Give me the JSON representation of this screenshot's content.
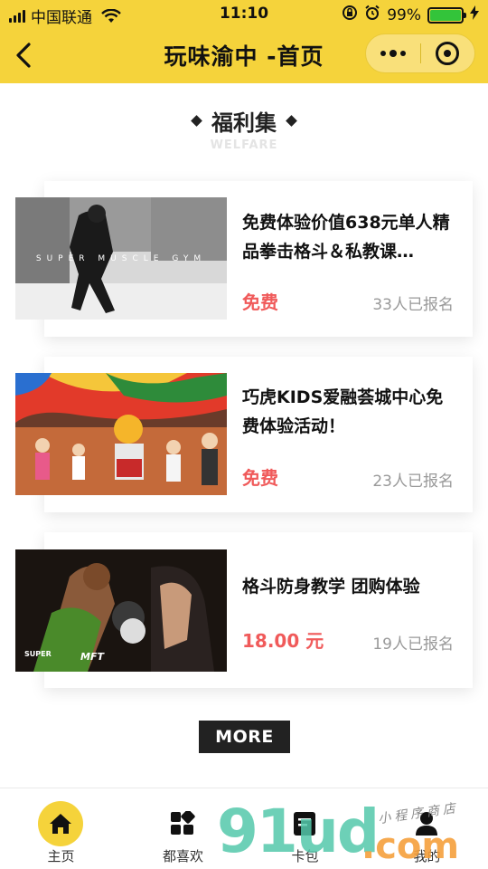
{
  "status_bar": {
    "carrier": "中国联通",
    "time": "11:10",
    "battery": "99%",
    "battery_level": 0.99
  },
  "nav": {
    "title": "玩味渝中 -首页"
  },
  "section": {
    "title": "福利集",
    "subtitle": "WELFARE"
  },
  "cards": [
    {
      "title": "免费体验价值638元单人精品拳击格斗＆私教课…",
      "price": "免费",
      "count": "33人已报名",
      "image": "boxing-gym-photo"
    },
    {
      "title": "巧虎KIDS爱融荟城中心免费体验活动！",
      "price": "免费",
      "count": "23人已报名",
      "image": "kids-event-photo"
    },
    {
      "title": "格斗防身教学 团购体验",
      "price": "18.00 元",
      "count": "19人已报名",
      "image": "fighting-photo"
    }
  ],
  "more_label": "MORE",
  "tabs": [
    {
      "label": "主页",
      "icon": "home-icon"
    },
    {
      "label": "都喜欢",
      "icon": "apps-icon"
    },
    {
      "label": "卡包",
      "icon": "card-icon"
    },
    {
      "label": "我的",
      "icon": "user-icon"
    }
  ],
  "watermark": {
    "main": "91ud",
    "suffix": ".com",
    "small": "小程序商店"
  },
  "colors": {
    "accent": "#f5d33b",
    "price": "#f05a5a"
  }
}
